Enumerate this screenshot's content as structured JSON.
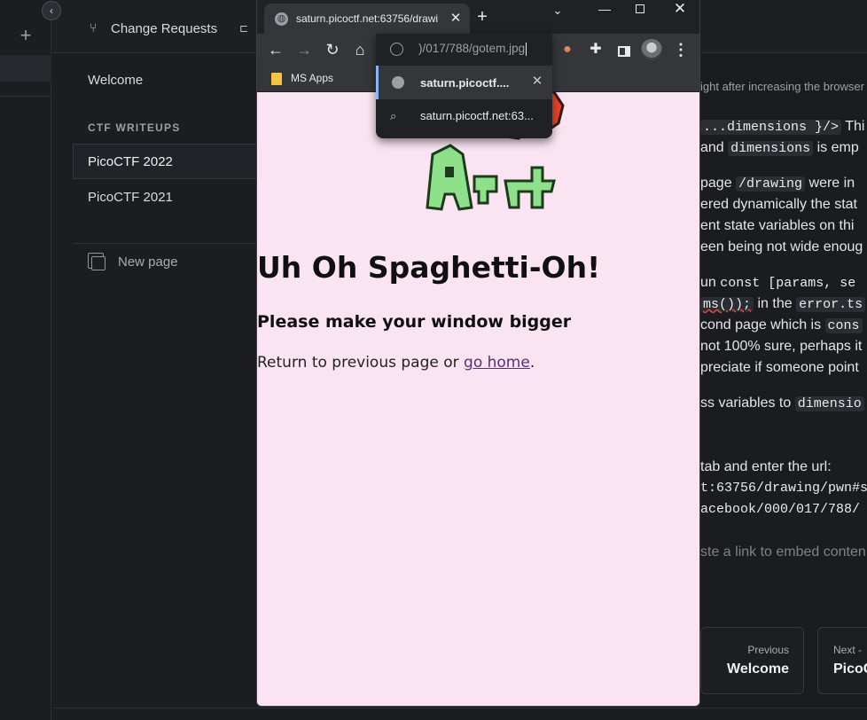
{
  "background_app": {
    "topbar": {
      "change_requests": "Change Requests"
    },
    "sidebar": {
      "welcome": "Welcome",
      "section_title": "CTF WRITEUPS",
      "items": [
        "PicoCTF 2022",
        "PicoCTF 2021"
      ],
      "new_page": "New page"
    },
    "content": {
      "line1": "ight after increasing the browser",
      "line2_code": "...dimensions }/>",
      "line2_text": "Thi",
      "line3_text": "and",
      "line3_code": "dimensions",
      "line3_tail": "is emp",
      "line4_text": "page",
      "line4_code": "/drawing",
      "line4_tail": "were in",
      "line5": "ered dynamically the stat",
      "line6": "ent state variables on thi",
      "line7": "een being not wide enoug",
      "line8_text": "un",
      "line8_code": "const [params, se",
      "line9_code": "ms());",
      "line9_text": "in the",
      "line9_code2": "error.ts",
      "line10_text": "cond page which is",
      "line10_code": "cons",
      "line11": "not 100% sure, perhaps it",
      "line12": "preciate if someone point",
      "line13_text": "ss variables to",
      "line13_code": "dimensio",
      "line14": "tab and enter the url:",
      "line15": "t:63756/drawing/pwn#s",
      "line16": "acebook/000/017/788/",
      "line17": "ste a link to embed conten"
    },
    "prev_card": {
      "label": "Previous",
      "title": "Welcome"
    },
    "next_card": {
      "label": "Next -",
      "title": "PicoC"
    }
  },
  "browser": {
    "tab_title": "saturn.picoctf.net:63756/drawi",
    "bookmark": "MS Apps",
    "omnibox": {
      "text": ")/017/788/gotem.jpg",
      "suggestions": [
        {
          "icon": "globe-icon",
          "text": "saturn.picoctf...."
        },
        {
          "icon": "search-icon",
          "text": "saturn.picoctf.net:63..."
        }
      ]
    }
  },
  "page": {
    "title": "Uh Oh Spaghetti-Oh!",
    "subtitle": "Please make your window bigger",
    "body_prefix": "Return to previous page or ",
    "link": "go home",
    "body_suffix": "."
  },
  "colors": {
    "page_bg": "#fae4f1",
    "link": "#5b2d7a",
    "chrome_dark": "#202124",
    "chrome_toolbar": "#35363a",
    "app_bg": "#1a1c1f"
  }
}
